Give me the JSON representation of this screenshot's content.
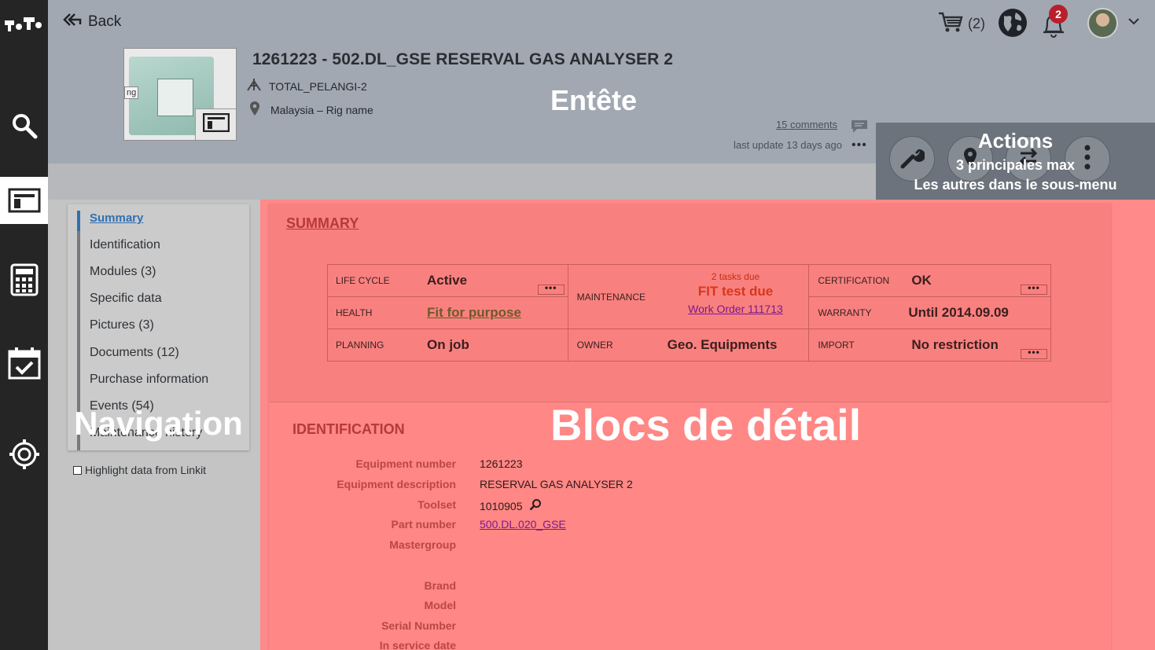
{
  "rail": {
    "logo": "T.T",
    "icons": [
      "search-icon",
      "asset-icon",
      "calculator-icon",
      "calendar-check-icon",
      "settings-icon"
    ]
  },
  "header": {
    "back_label": "Back",
    "title": "1261223 - 502.DL_GSE RESERVAL GAS ANALYSER 2",
    "site": "TOTAL_PELANGI-2",
    "location": "Malaysia – Rig name",
    "annotation": "Entête",
    "comments": "15 comments",
    "last_update": "last update 13 days ago",
    "more": "•••",
    "thumb_tag": "ng",
    "cart_count": "(2)",
    "notif_count": "2"
  },
  "actions": {
    "title": "Actions",
    "sub1": "3 principales max",
    "sub2": "Les autres dans le sous-menu"
  },
  "nav": {
    "items": [
      {
        "label": "Summary"
      },
      {
        "label": "Identification"
      },
      {
        "label": "Modules (3)"
      },
      {
        "label": "Specific data"
      },
      {
        "label": "Pictures (3)"
      },
      {
        "label": "Documents (12)"
      },
      {
        "label": "Purchase information"
      },
      {
        "label": "Events (54)"
      },
      {
        "label": "Maintenance history"
      }
    ],
    "annotation": "Navigation",
    "highlight": "Highlight data from Linkit"
  },
  "detail": {
    "annotation": "Blocs de détail",
    "summary_title": "SUMMARY",
    "summary": {
      "life_cycle_label": "LIFE CYCLE",
      "life_cycle": "Active",
      "health_label": "HEALTH",
      "health": "Fit for purpose",
      "planning_label": "PLANNING",
      "planning": "On job",
      "maintenance_label": "MAINTENANCE",
      "tasks_due": "2 tasks due",
      "fit_test": "FIT test due",
      "work_order": "Work Order 111713",
      "owner_label": "OWNER",
      "owner": "Geo. Equipments",
      "certification_label": "CERTIFICATION",
      "certification": "OK",
      "warranty_label": "WARRANTY",
      "warranty": "Until 2014.09.09",
      "import_label": "IMPORT",
      "import": "No restriction",
      "more": "•••"
    },
    "identification_title": "IDENTIFICATION",
    "identification": [
      {
        "key": "Equipment number",
        "value": "1261223"
      },
      {
        "key": "Equipment description",
        "value": "RESERVAL GAS ANALYSER 2"
      },
      {
        "key": "Toolset",
        "value": "1010905"
      },
      {
        "key": "Part number",
        "value": "500.DL.020_GSE"
      },
      {
        "key": "Mastergroup",
        "value": ""
      },
      {
        "key": "",
        "value": ""
      },
      {
        "key": "Brand",
        "value": ""
      },
      {
        "key": "Model",
        "value": ""
      },
      {
        "key": "Serial Number",
        "value": ""
      },
      {
        "key": "In service date",
        "value": ""
      }
    ]
  }
}
